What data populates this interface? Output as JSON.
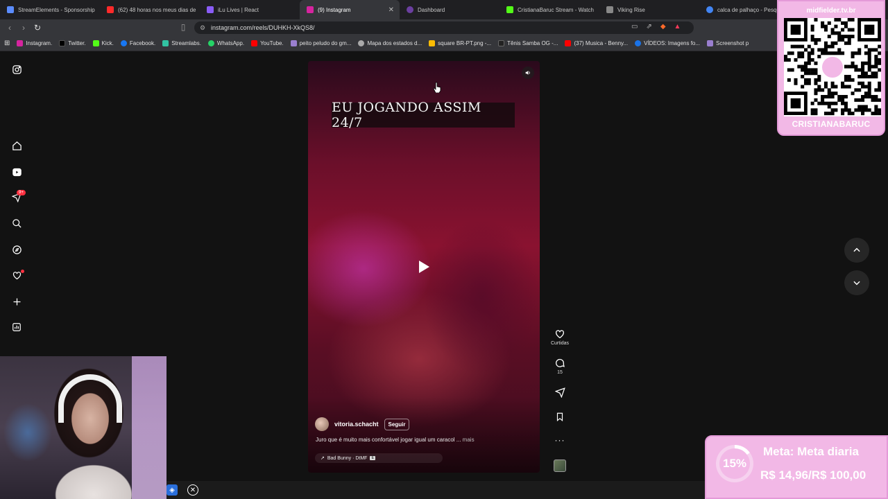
{
  "browser": {
    "tabs": [
      {
        "title": "StreamElements - Sponsorship",
        "color": "#5b8cff"
      },
      {
        "title": "(62) 48 horas nos meus dias de",
        "color": "#ff2a2a"
      },
      {
        "title": "iLu Lives | React",
        "color": "#8a5cf6"
      },
      {
        "title": "(9) Instagram",
        "color": "#d6249f",
        "active": true
      },
      {
        "title": "Dashboard",
        "color": "#6b3fa0"
      },
      {
        "title": "CristianaBaruc Stream - Watch",
        "color": "#53fc18"
      },
      {
        "title": "Viking Rise",
        "color": "#888888"
      },
      {
        "title": "calca de palhaço - Pesquisa",
        "color": "#4285f4"
      }
    ],
    "url": "instagram.com/reels/DUHKH-XkQS8/",
    "bookmarks": [
      {
        "label": "Instagram.",
        "color": "#d6249f"
      },
      {
        "label": "Twitter.",
        "color": "#000000"
      },
      {
        "label": "Kick.",
        "color": "#53fc18"
      },
      {
        "label": "Facebook.",
        "color": "#1877f2"
      },
      {
        "label": "Streamlabs.",
        "color": "#31c3a2"
      },
      {
        "label": "WhatsApp.",
        "color": "#25d366"
      },
      {
        "label": "YouTube.",
        "color": "#ff0000"
      },
      {
        "label": "peito peludo do gm...",
        "color": "#9a7fcf"
      },
      {
        "label": "Mapa dos estados d...",
        "color": "#aaaaaa"
      },
      {
        "label": "square BR-PT.png -...",
        "color": "#fbbc04"
      },
      {
        "label": "Tênis Samba OG -...",
        "color": "#222222"
      },
      {
        "label": "(37) Musica - Benny...",
        "color": "#ff0000"
      },
      {
        "label": "VÍDEOS: Imagens fo...",
        "color": "#1a73e8"
      },
      {
        "label": "Screenshot p",
        "color": "#9a7fcf"
      }
    ]
  },
  "reel": {
    "overlay_text": "EU JOGANDO ASSIM 24/7",
    "author": "vitoria.schacht",
    "follow_label": "Seguir",
    "caption": "Juro que é muito mais confortável jogar igual um caracol ...",
    "caption_more": "mais",
    "audio": "Bad Bunny · DtMF"
  },
  "actions": {
    "like_label": "Curtidas",
    "comment_count": "15"
  },
  "overlay": {
    "qr_site": "midfielder.tv.br",
    "qr_name": "CRISTIANABARUC",
    "goal_percent": "15%",
    "goal_progress": 0.15,
    "goal_title": "Meta: Meta diaria",
    "goal_amount": "R$ 14,96/R$ 100,00"
  }
}
